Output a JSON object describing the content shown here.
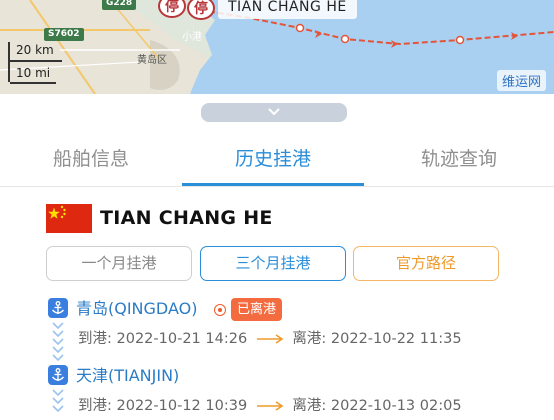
{
  "map": {
    "ship_label": "TIAN CHANG HE",
    "pin_char": "停",
    "roads": [
      "G228",
      "S7602"
    ],
    "places": [
      "黄岛区",
      "小港"
    ],
    "scale_km": "20 km",
    "scale_mi": "10 mi",
    "watermark": "维运网"
  },
  "tabs": [
    {
      "label": "船舶信息",
      "active": false
    },
    {
      "label": "历史挂港",
      "active": true
    },
    {
      "label": "轨迹查询",
      "active": false
    }
  ],
  "vessel": {
    "name": "TIAN CHANG HE",
    "flag_icon": "china-flag-icon"
  },
  "filters": {
    "one_month": "一个月挂港",
    "three_month": "三个月挂港",
    "official_route": "官方路径"
  },
  "port_calls": [
    {
      "port": "青岛(QINGDAO)",
      "status": "已离港",
      "arrive_label": "到港:",
      "arrive_time": "2022-10-21 14:26",
      "depart_label": "离港:",
      "depart_time": "2022-10-22 11:35"
    },
    {
      "port": "天津(TIANJIN)",
      "arrive_label": "到港:",
      "arrive_time": "2022-10-12 10:39",
      "depart_label": "离港:",
      "depart_time": "2022-10-13 02:05"
    }
  ],
  "colors": {
    "accent": "#2a8ed8",
    "status": "#f36b3f",
    "route": "#ef9b2b",
    "track": "#e2553a"
  }
}
